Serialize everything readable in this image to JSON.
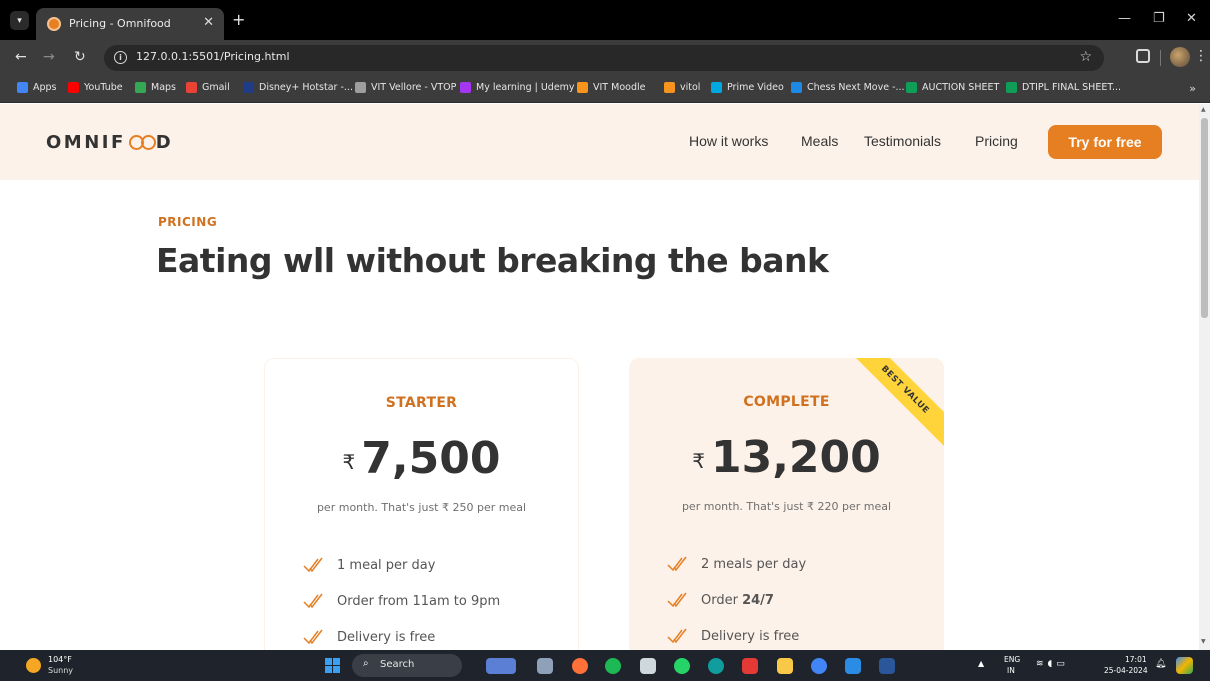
{
  "browser": {
    "tab_title": "Pricing - Omnifood",
    "url": "127.0.0.1:5501/Pricing.html",
    "bookmarks": [
      {
        "label": "Apps",
        "color": "#4285f4"
      },
      {
        "label": "YouTube",
        "color": "#ff0000"
      },
      {
        "label": "Maps",
        "color": "#34a853"
      },
      {
        "label": "Gmail",
        "color": "#ea4335"
      },
      {
        "label": "Disney+ Hotstar -...",
        "color": "#1f3c88"
      },
      {
        "label": "VIT Vellore - VTOP",
        "color": "#9e9e9e"
      },
      {
        "label": "My learning | Udemy",
        "color": "#a435f0"
      },
      {
        "label": "VIT Moodle",
        "color": "#f7941d"
      },
      {
        "label": "vitol",
        "color": "#f7941d"
      },
      {
        "label": "Prime Video",
        "color": "#00a8e1"
      },
      {
        "label": "Chess Next Move -...",
        "color": "#1e88e5"
      },
      {
        "label": "AUCTION SHEET",
        "color": "#0f9d58"
      },
      {
        "label": "DTIPL FINAL SHEET...",
        "color": "#0f9d58"
      }
    ],
    "more_bookmarks": "»"
  },
  "site": {
    "logo_prefix": "OMNIF",
    "logo_suffix": "D",
    "nav": [
      "How it works",
      "Meals",
      "Testimonials",
      "Pricing"
    ],
    "cta_label": "Try for free",
    "accent_color": "#e67e22",
    "section_tint": "#fdf2e9"
  },
  "pricing": {
    "subheading": "PRICING",
    "heading": "Eating wll without breaking the bank",
    "plans": [
      {
        "name": "STARTER",
        "currency": "₹",
        "price": "7,500",
        "price_text": "per month. That's just ₹ 250 per meal",
        "features": [
          {
            "text": "1 meal per day"
          },
          {
            "text": "Order from 11am to 9pm"
          },
          {
            "text": "Delivery is free"
          }
        ]
      },
      {
        "name": "COMPLETE",
        "currency": "₹",
        "price": "13,200",
        "price_text": "per month. That's just ₹ 220 per meal",
        "ribbon": "BEST VALUE",
        "features": [
          {
            "text": "2 meals per day"
          },
          {
            "text_before": "Order ",
            "bold": "24/7"
          },
          {
            "text": "Delivery is free"
          }
        ]
      }
    ]
  },
  "taskbar": {
    "weather_temp": "104°F",
    "weather_desc": "Sunny",
    "search_label": "Search",
    "lang_top": "ENG",
    "lang_bottom": "IN",
    "time": "17:01",
    "date": "25-04-2024"
  }
}
